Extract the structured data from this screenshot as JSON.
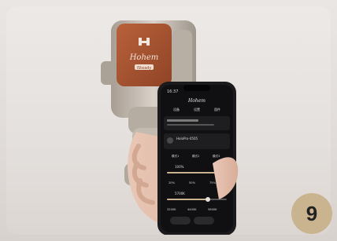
{
  "brand": {
    "name": "Hohem",
    "sub": "iSteady"
  },
  "phone_screen": {
    "time": "16:37",
    "header": "Hohem",
    "tabs": [
      "设备",
      "设置",
      "固件"
    ],
    "device_name": "HoloPro-0505",
    "preset_tabs": [
      "模式1",
      "模式2",
      "模式3"
    ],
    "slider1_label": "100%",
    "speed_options": [
      "20%",
      "50%",
      "75%"
    ],
    "slider2_label": "5700K",
    "temp_options": [
      "3200K",
      "4400K",
      "5600K"
    ]
  },
  "step_badge": {
    "number": "9"
  }
}
